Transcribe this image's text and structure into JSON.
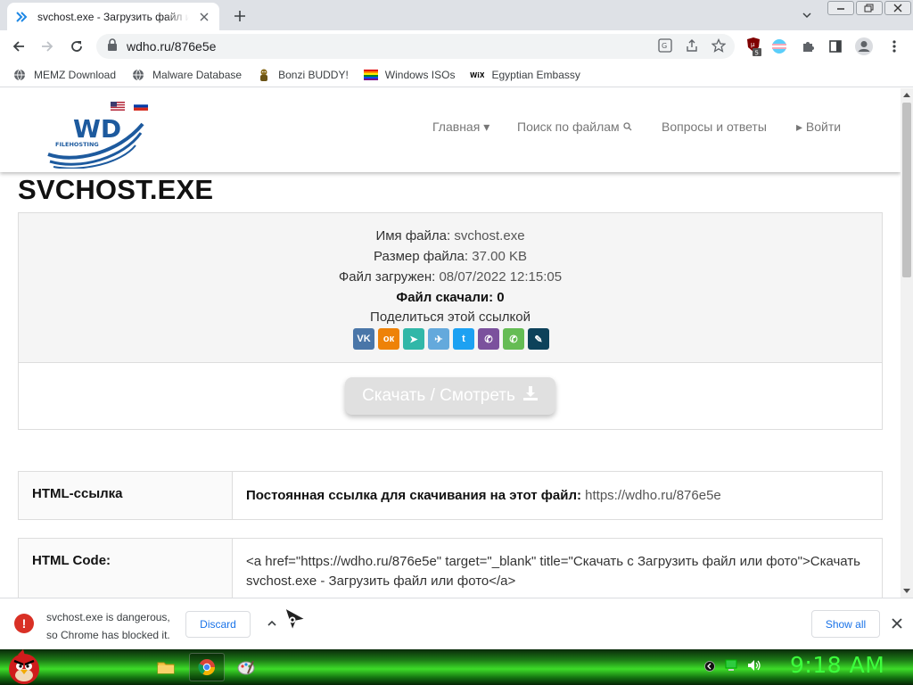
{
  "browser": {
    "tab_title": "svchost.exe - Загрузить файл или фото",
    "url": "wdho.ru/876e5e",
    "extension_badge": "5"
  },
  "bookmarks": [
    {
      "label": "MEMZ Download",
      "icon": "globe-icon"
    },
    {
      "label": "Malware Database",
      "icon": "globe-icon"
    },
    {
      "label": "Bonzi BUDDY!",
      "icon": "bonzi-icon"
    },
    {
      "label": "Windows ISOs",
      "icon": "rainbow-flag-icon"
    },
    {
      "label": "Egyptian Embassy",
      "icon": "wix-icon"
    }
  ],
  "site": {
    "logo_text": "WD",
    "logo_subtext": "FILEHOSTING",
    "nav": {
      "home": "Главная",
      "search": "Поиск по файлам",
      "faq": "Вопросы и ответы",
      "login": "Войти"
    }
  },
  "file": {
    "title": "SVCHOST.EXE",
    "name_label": "Имя файла:",
    "name_value": "svchost.exe",
    "size_label": "Размер файла:",
    "size_value": "37.00 KB",
    "uploaded_label": "Файл загружен:",
    "uploaded_value": "08/07/2022 12:15:05",
    "downloads_label": "Файл скачали:",
    "downloads_value": "0",
    "share_label": "Поделиться этой ссылкой",
    "download_button": "Скачать / Смотреть"
  },
  "share_buttons": [
    {
      "name": "vk",
      "text": "VK",
      "color": "#4a76a8"
    },
    {
      "name": "odnoklassniki",
      "text": "ок",
      "color": "#ee8208"
    },
    {
      "name": "yandex-messenger",
      "text": "➤",
      "color": "#31b7a8"
    },
    {
      "name": "telegram",
      "text": "✈",
      "color": "#64a9dc"
    },
    {
      "name": "twitter",
      "text": "t",
      "color": "#1da1f2"
    },
    {
      "name": "viber",
      "text": "✆",
      "color": "#7b519d"
    },
    {
      "name": "whatsapp",
      "text": "✆",
      "color": "#65bc54"
    },
    {
      "name": "livejournal",
      "text": "✎",
      "color": "#0d425a"
    }
  ],
  "rows": {
    "html_link_label": "HTML-ссылка",
    "html_link_text": "Постоянная ссылка для скачивания на этот файл:",
    "html_link_url": "https://wdho.ru/876e5e",
    "html_code_label": "HTML Code:",
    "html_code_value": "<a href=\"https://wdho.ru/876e5e\" target=\"_blank\" title=\"Скачать с Загрузить файл или фото\">Скачать svchost.exe - Загрузить файл или фото</a>"
  },
  "download_bar": {
    "line1": "svchost.exe is dangerous,",
    "line2": "so Chrome has blocked it.",
    "discard": "Discard",
    "show_all": "Show all"
  },
  "taskbar": {
    "clock": "9:18 AM"
  }
}
